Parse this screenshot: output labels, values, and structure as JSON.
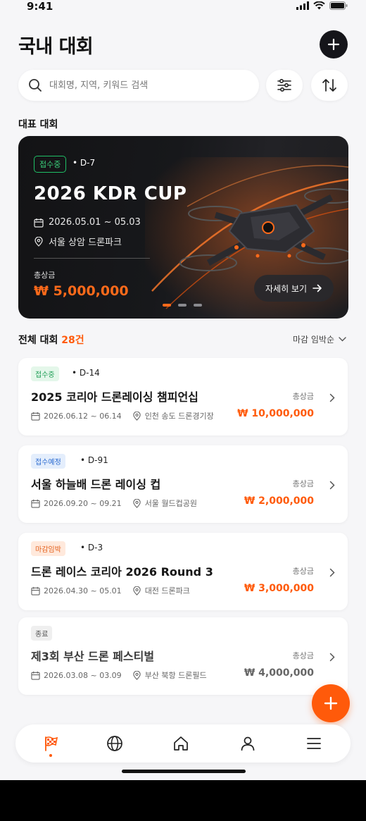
{
  "status_bar": {
    "time": "9:41"
  },
  "header": {
    "title": "국내 대회"
  },
  "search": {
    "placeholder": "대회명, 지역, 키워드 검색"
  },
  "featured_section": {
    "label": "대표 대회"
  },
  "featured": {
    "status": "접수중",
    "dday": "• D-7",
    "title": "2026 KDR CUP",
    "dates": "2026.05.01 ~ 05.03",
    "location": "서울 상암 드론파크",
    "prize_label": "총상금",
    "prize": "₩ 5,000,000",
    "detail_button": "자세히 보기",
    "carousel_index": 1,
    "carousel_total": 3
  },
  "list": {
    "title": "전체 대회",
    "count": "28건",
    "sort": "마감 임박순",
    "items": [
      {
        "status": "접수중",
        "status_color": "green",
        "dday": "• D-14",
        "name": "2025 코리아 드론레이싱 챔피언십",
        "dates": "2026.06.12 ~ 06.14",
        "location": "인천 송도 드론경기장",
        "prize_label": "총상금",
        "prize": "₩ 10,000,000"
      },
      {
        "status": "접수예정",
        "status_color": "blue",
        "dday": "• D-91",
        "name": "서울 하늘배 드론 레이싱 컵",
        "dates": "2026.09.20 ~ 09.21",
        "location": "서울 월드컵공원",
        "prize_label": "총상금",
        "prize": "₩ 2,000,000"
      },
      {
        "status": "마감임박",
        "status_color": "orange",
        "dday": "• D-3",
        "name": "드론 레이스 코리아 2026 Round 3",
        "dates": "2026.04.30 ~ 05.01",
        "location": "대전 드론파크",
        "prize_label": "총상금",
        "prize": "₩ 3,000,000"
      },
      {
        "status": "종료",
        "status_color": "gray",
        "dday": "",
        "name": "제3회 부산 드론 페스티벌",
        "dates": "2026.03.08 ~ 03.09",
        "location": "부산 북항 드론필드",
        "prize_label": "총상금",
        "prize": "₩ 4,000,000"
      }
    ]
  },
  "colors": {
    "accent": "#ff5a0a",
    "dark": "#15151a",
    "green": "#1e9e55",
    "blue": "#2a6ad0"
  },
  "icons": [
    "plus-icon",
    "search-icon",
    "filter-sliders-icon",
    "sort-arrows-icon",
    "calendar-icon",
    "location-pin-icon",
    "chevron-right-icon",
    "chevron-down-icon",
    "arrow-right-icon",
    "checkered-flag-icon",
    "globe-icon",
    "home-icon",
    "person-icon",
    "menu-icon"
  ],
  "bottom_nav": {
    "active": "competitions"
  }
}
